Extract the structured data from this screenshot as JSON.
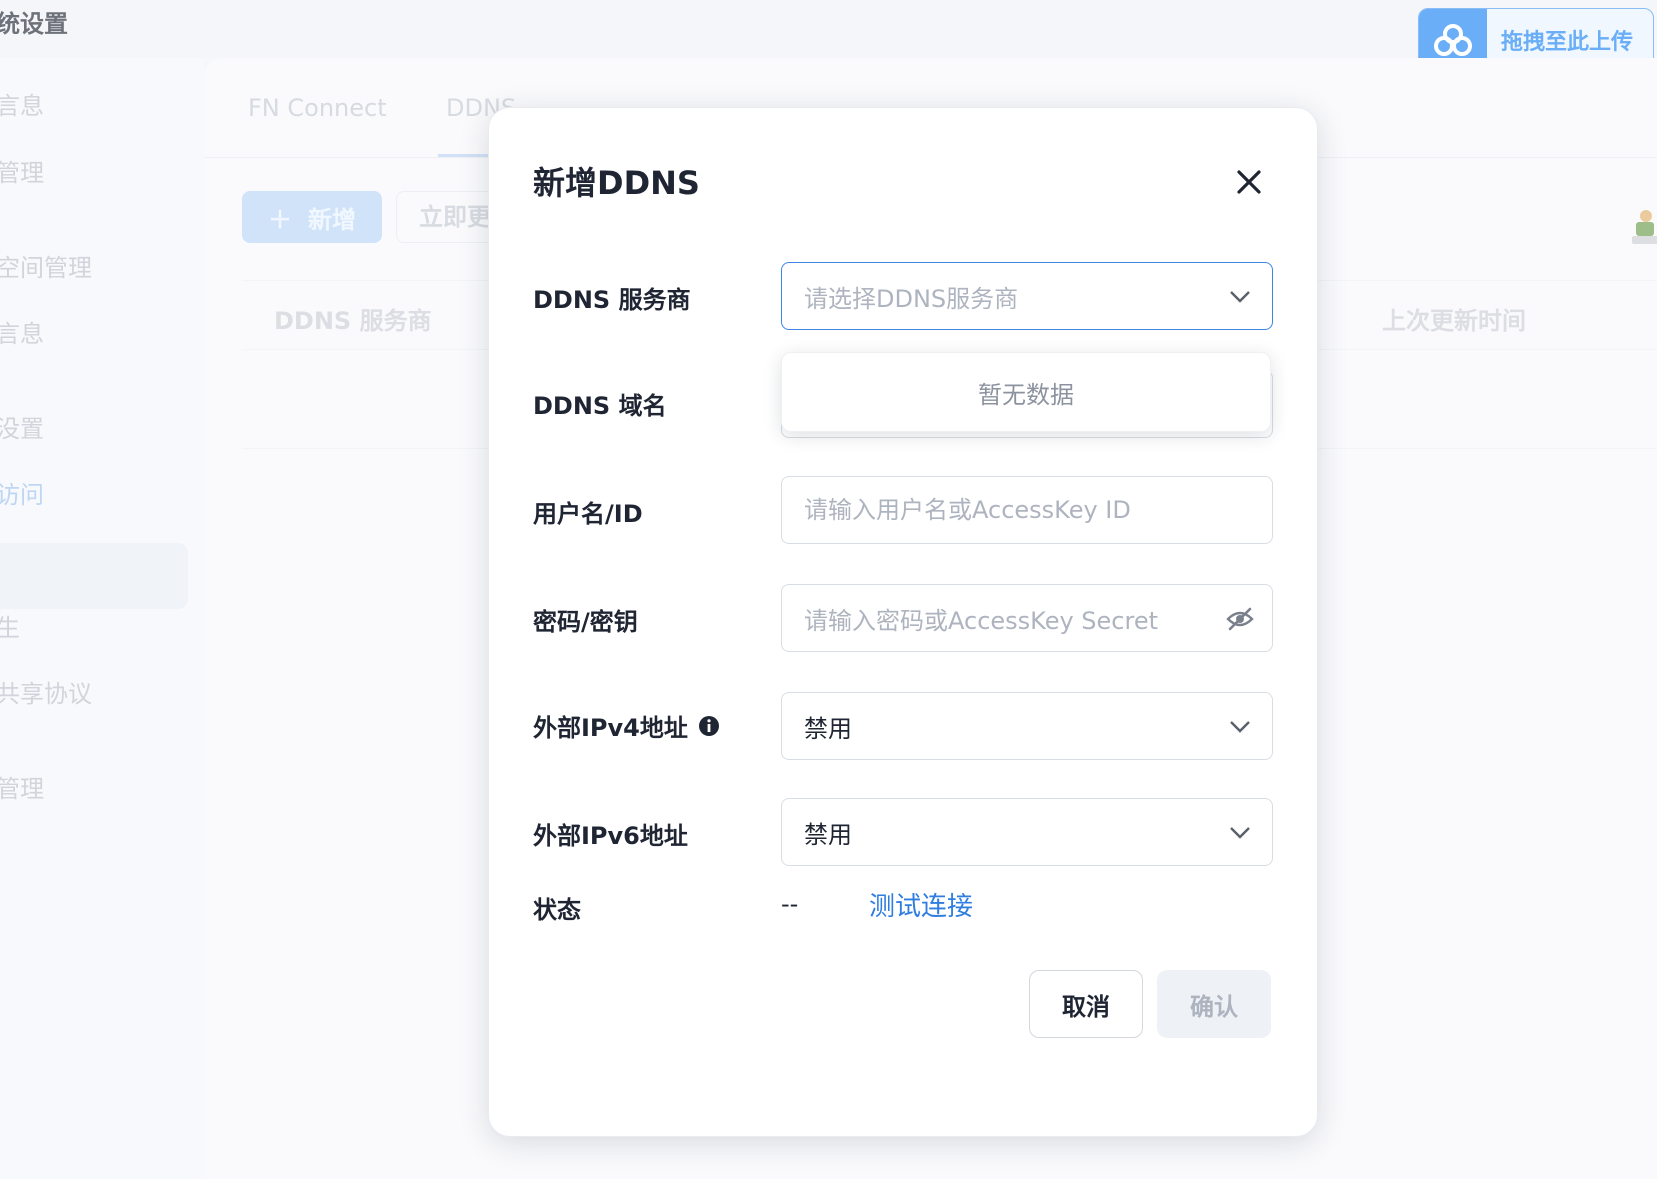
{
  "app": {
    "title": "统设置",
    "upload_button": "拖拽至此上传"
  },
  "sidebar": {
    "items": [
      {
        "label": "言息",
        "active": false
      },
      {
        "label": "管理",
        "active": false
      },
      {
        "label": "空间管理",
        "active": false
      },
      {
        "label": "言息",
        "active": false
      },
      {
        "label": "没置",
        "active": false
      },
      {
        "label": "访问",
        "active": true
      },
      {
        "label": "生",
        "active": false
      },
      {
        "label": "共享协议",
        "active": false
      },
      {
        "label": "管理",
        "active": false
      }
    ]
  },
  "main": {
    "tabs": [
      {
        "label": "FN Connect"
      },
      {
        "label": "DDNS"
      }
    ],
    "toolbar": {
      "add_label": "新增",
      "refresh_label": "立即更"
    },
    "table": {
      "columns": [
        "DDNS 服务商",
        "上次更新时间"
      ]
    }
  },
  "modal": {
    "title": "新增DDNS",
    "fields": {
      "provider": {
        "label": "DDNS 服务商",
        "placeholder": "请选择DDNS服务商"
      },
      "domain": {
        "label": "DDNS 域名"
      },
      "username": {
        "label": "用户名/ID",
        "placeholder": "请输入用户名或AccessKey ID"
      },
      "password": {
        "label": "密码/密钥",
        "placeholder": "请输入密码或AccessKey Secret"
      },
      "ipv4": {
        "label": "外部IPv4地址",
        "value": "禁用"
      },
      "ipv6": {
        "label": "外部IPv6地址",
        "value": "禁用"
      },
      "status": {
        "label": "状态",
        "value": "--",
        "test_link": "测试连接"
      }
    },
    "dropdown": {
      "empty_text": "暂无数据"
    },
    "cancel_label": "取消",
    "confirm_label": "确认"
  },
  "colors": {
    "accent": "#2f7de0",
    "upload_blue": "#1a83f2",
    "focus_border": "#3d86e6"
  }
}
